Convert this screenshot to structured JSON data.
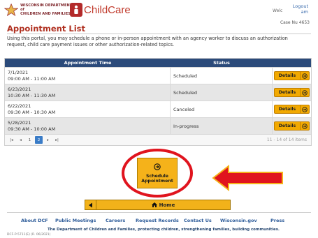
{
  "header": {
    "dcf_logo_lines": [
      "WISCONSIN DEPARTMENT of",
      "CHILDREN AND FAMILIES"
    ],
    "childcare_logo": "ChildCare",
    "welcome": "Welc",
    "logout_lines": [
      "Logout",
      "am"
    ],
    "case_number": "Case Nu          4653"
  },
  "page": {
    "title": "Appointment List",
    "intro": "Using this portal, you may schedule a phone or in-person appointment with an agency worker to discuss an authorization request, child care payment issues or other authorization-related topics."
  },
  "grid": {
    "columns": [
      "Appointment Time",
      "Status",
      ""
    ],
    "rows": [
      {
        "date": "7/1/2021",
        "time": "09:00 AM - 11:00 AM",
        "status": "Scheduled",
        "action": "Details"
      },
      {
        "date": "6/23/2021",
        "time": "10:30 AM - 11:30 AM",
        "status": "Scheduled",
        "action": "Details"
      },
      {
        "date": "6/22/2021",
        "time": "09:30 AM - 10:30 AM",
        "status": "Canceled",
        "action": "Details"
      },
      {
        "date": "5/28/2021",
        "time": "09:30 AM - 10:00 AM",
        "status": "In-progress",
        "action": "Details"
      }
    ],
    "pager": {
      "pages": [
        "1",
        "2"
      ],
      "current_page": "2",
      "info": "11 - 14 of 14 items"
    }
  },
  "schedule_button": {
    "line1": "Schedule",
    "line2": "Appointment"
  },
  "home_button": {
    "label": "Home"
  },
  "footer": {
    "links": [
      "About DCF",
      "Public Meetings",
      "Careers",
      "Request Records",
      "Contact Us",
      "Wisconsin.gov",
      "Press"
    ],
    "tagline": "The Department of Children and Families, protecting children, strengthening families, building communities.",
    "copyright": "DCF-P-5711(E) (R. 06/2021)"
  },
  "colors": {
    "header_bar": "#2b4a7a",
    "accent_gold": "#f2a900",
    "title_red": "#b03020",
    "annotation_red": "#e0141e",
    "link_blue": "#2f5d9a"
  },
  "icons": [
    "dcf-star-icon",
    "childcare-badge-icon",
    "arrow-circle-right-icon",
    "chevron-left-icon",
    "home-icon",
    "red-arrow-annotation"
  ]
}
